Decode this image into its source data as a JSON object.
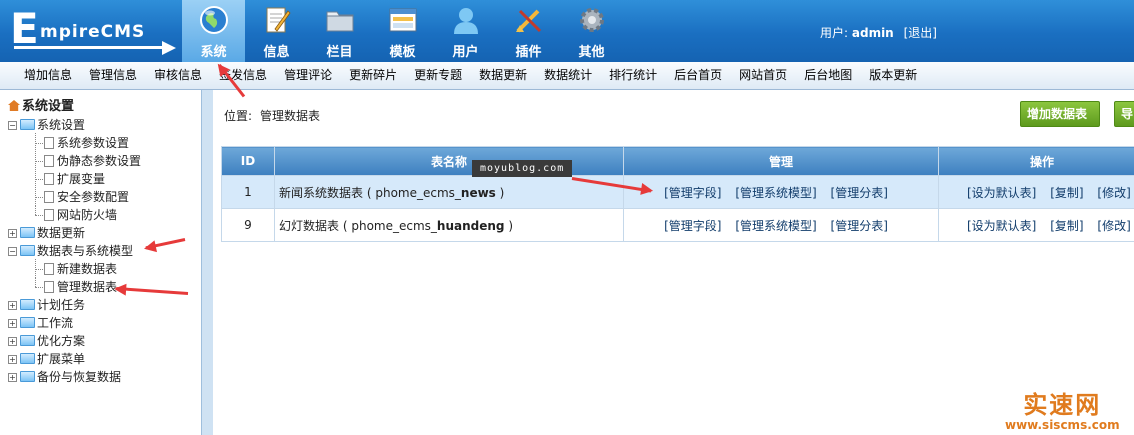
{
  "header": {
    "logo_text_e": "E",
    "logo_text_rest": "mpireCMS",
    "nav": [
      {
        "label": "系统",
        "icon": "globe-icon",
        "active": true
      },
      {
        "label": "信息",
        "icon": "edit-document-icon",
        "active": false
      },
      {
        "label": "栏目",
        "icon": "folder-icon",
        "active": false
      },
      {
        "label": "模板",
        "icon": "template-window-icon",
        "active": false
      },
      {
        "label": "用户",
        "icon": "user-icon",
        "active": false
      },
      {
        "label": "插件",
        "icon": "tools-icon",
        "active": false
      },
      {
        "label": "其他",
        "icon": "gear-icon",
        "active": false
      }
    ],
    "user_prefix": "用户:",
    "username": "admin",
    "logout": "[退出]"
  },
  "submenu": [
    "增加信息",
    "管理信息",
    "审核信息",
    "签发信息",
    "管理评论",
    "更新碎片",
    "更新专题",
    "数据更新",
    "数据统计",
    "排行统计",
    "后台首页",
    "网站首页",
    "后台地图",
    "版本更新"
  ],
  "sidebar": {
    "root": "系统设置",
    "items": [
      {
        "label": "系统设置",
        "expanded": true,
        "children": [
          "系统参数设置",
          "伪静态参数设置",
          "扩展变量",
          "安全参数配置",
          "网站防火墙"
        ]
      },
      {
        "label": "数据更新",
        "expanded": false,
        "children": []
      },
      {
        "label": "数据表与系统模型",
        "expanded": true,
        "children": [
          "新建数据表",
          "管理数据表"
        ]
      },
      {
        "label": "计划任务",
        "expanded": false,
        "children": []
      },
      {
        "label": "工作流",
        "expanded": false,
        "children": []
      },
      {
        "label": "优化方案",
        "expanded": false,
        "children": []
      },
      {
        "label": "扩展菜单",
        "expanded": false,
        "children": []
      },
      {
        "label": "备份与恢复数据",
        "expanded": false,
        "children": []
      }
    ]
  },
  "main": {
    "position_label": "位置:",
    "position_value": "管理数据表",
    "add_button": "增加数据表",
    "import_button": "导",
    "table": {
      "headers": [
        "ID",
        "表名称",
        "管理",
        "操作"
      ],
      "rows": [
        {
          "id": "1",
          "name": "新闻系统数据表",
          "table_prefix": "( phome_ecms_",
          "table_suffix": "news",
          "table_close": ")",
          "manage": [
            "[管理字段]",
            "[管理系统模型]",
            "[管理分表]"
          ],
          "ops": [
            "[设为默认表]",
            "[复制]",
            "[修改]"
          ]
        },
        {
          "id": "9",
          "name": "幻灯数据表",
          "table_prefix": "( phome_ecms_",
          "table_suffix": "huandeng",
          "table_close": ")",
          "manage": [
            "[管理字段]",
            "[管理系统模型]",
            "[管理分表]"
          ],
          "ops": [
            "[设为默认表]",
            "[复制]",
            "[修改]"
          ]
        }
      ]
    }
  },
  "watermark": "moyublog.com",
  "brand": {
    "name": "实速网",
    "url": "www.siscms.com"
  }
}
